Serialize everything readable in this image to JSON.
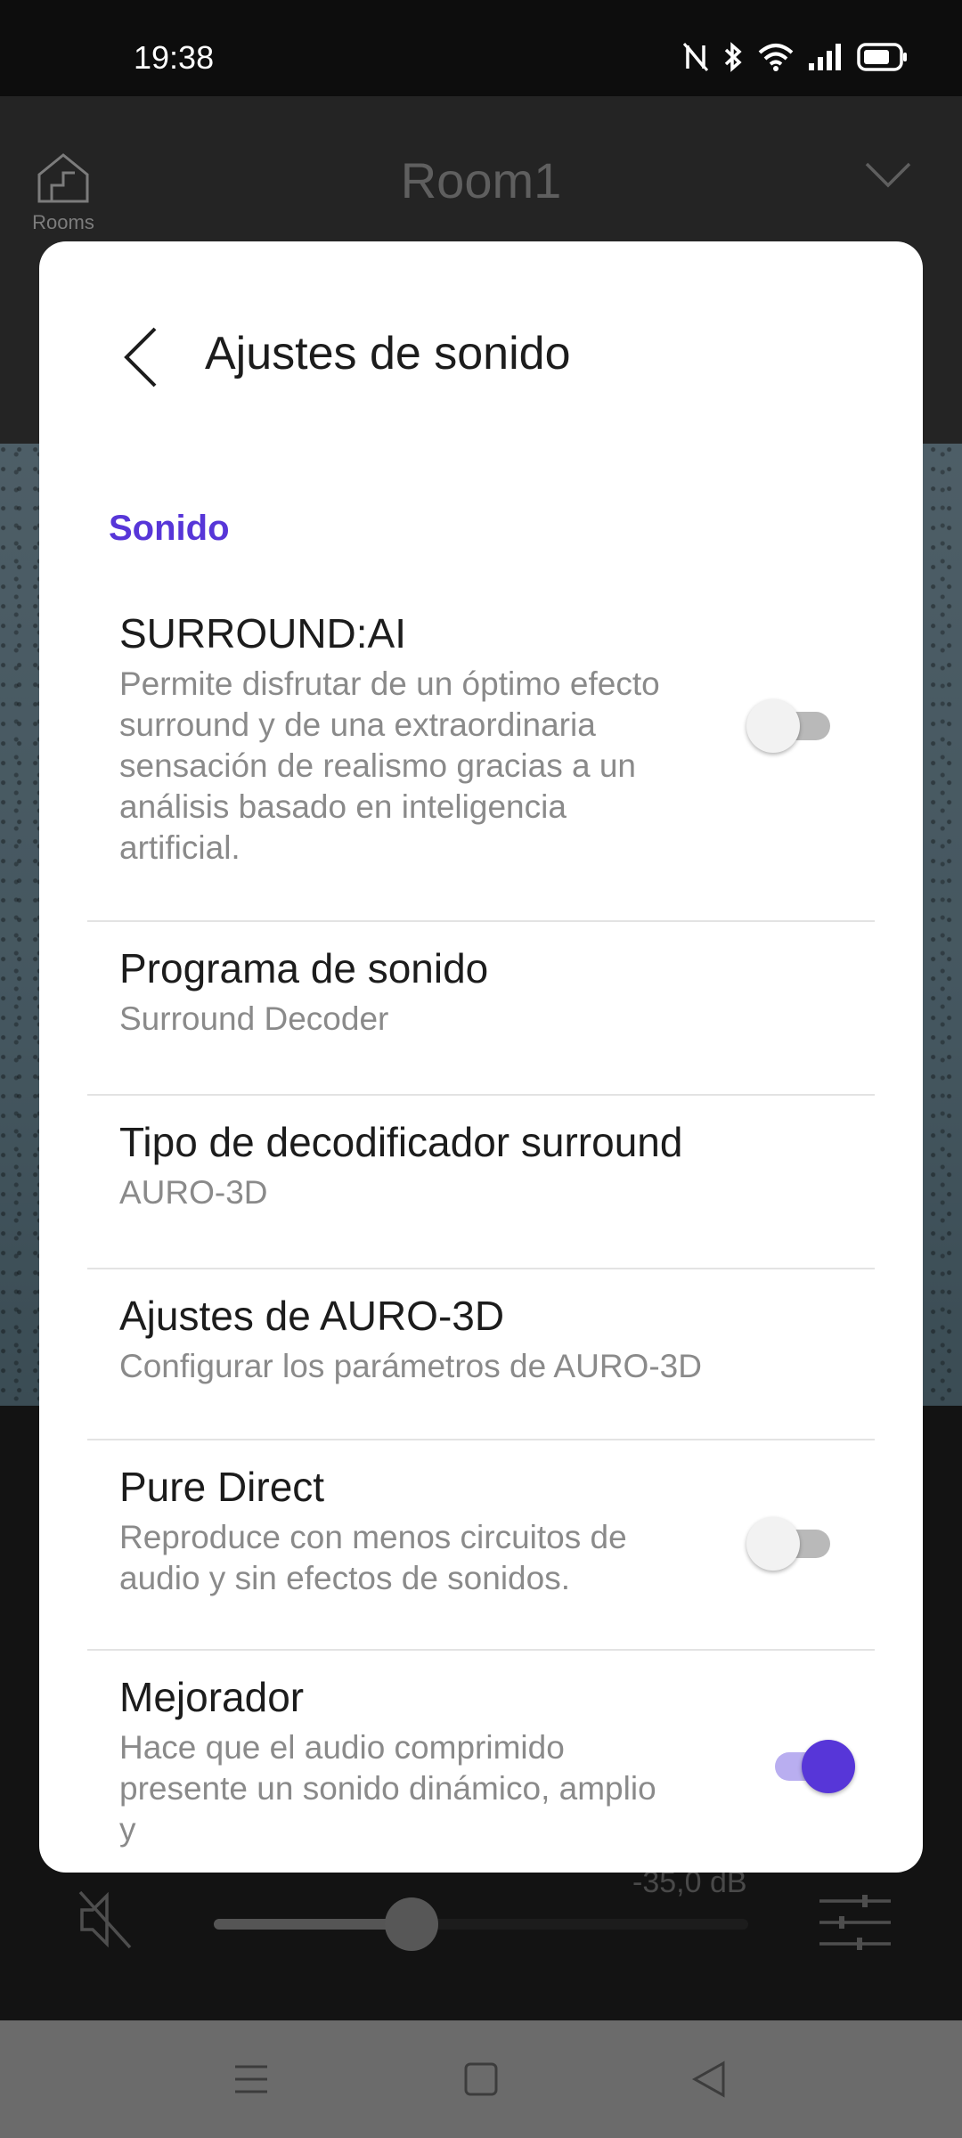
{
  "status_bar": {
    "time": "19:38",
    "icons": [
      "nfc-icon",
      "bluetooth-icon",
      "wifi-icon",
      "signal-icon",
      "battery-icon"
    ]
  },
  "app": {
    "rooms_label": "Rooms",
    "room_name": "Room1",
    "volume_db": "-35,0 dB",
    "volume_level_fraction": 0.37
  },
  "dialog": {
    "title": "Ajustes de sonido",
    "section_header": "Sonido",
    "items": [
      {
        "title": "SURROUND:AI",
        "subtitle": "Permite disfrutar de un óptimo efecto surround y de una extraordinaria sensación de realismo gracias a un análisis basado en inteligencia artificial.",
        "toggle": false
      },
      {
        "title": "Programa de sonido",
        "subtitle": "Surround Decoder"
      },
      {
        "title": "Tipo de decodificador surround",
        "subtitle": "AURO-3D"
      },
      {
        "title": "Ajustes de AURO-3D",
        "subtitle": "Configurar los parámetros de AURO-3D"
      },
      {
        "title": "Pure Direct",
        "subtitle": "Reproduce con menos circuitos de audio y sin efectos de sonidos.",
        "toggle": false
      },
      {
        "title": "Mejorador",
        "subtitle": "Hace que el audio comprimido presente un sonido dinámico, amplio y",
        "toggle": true
      }
    ]
  },
  "colors": {
    "accent": "#5736d8",
    "dialog_bg": "#ffffff",
    "nav_bar": "#6b6b6b"
  }
}
